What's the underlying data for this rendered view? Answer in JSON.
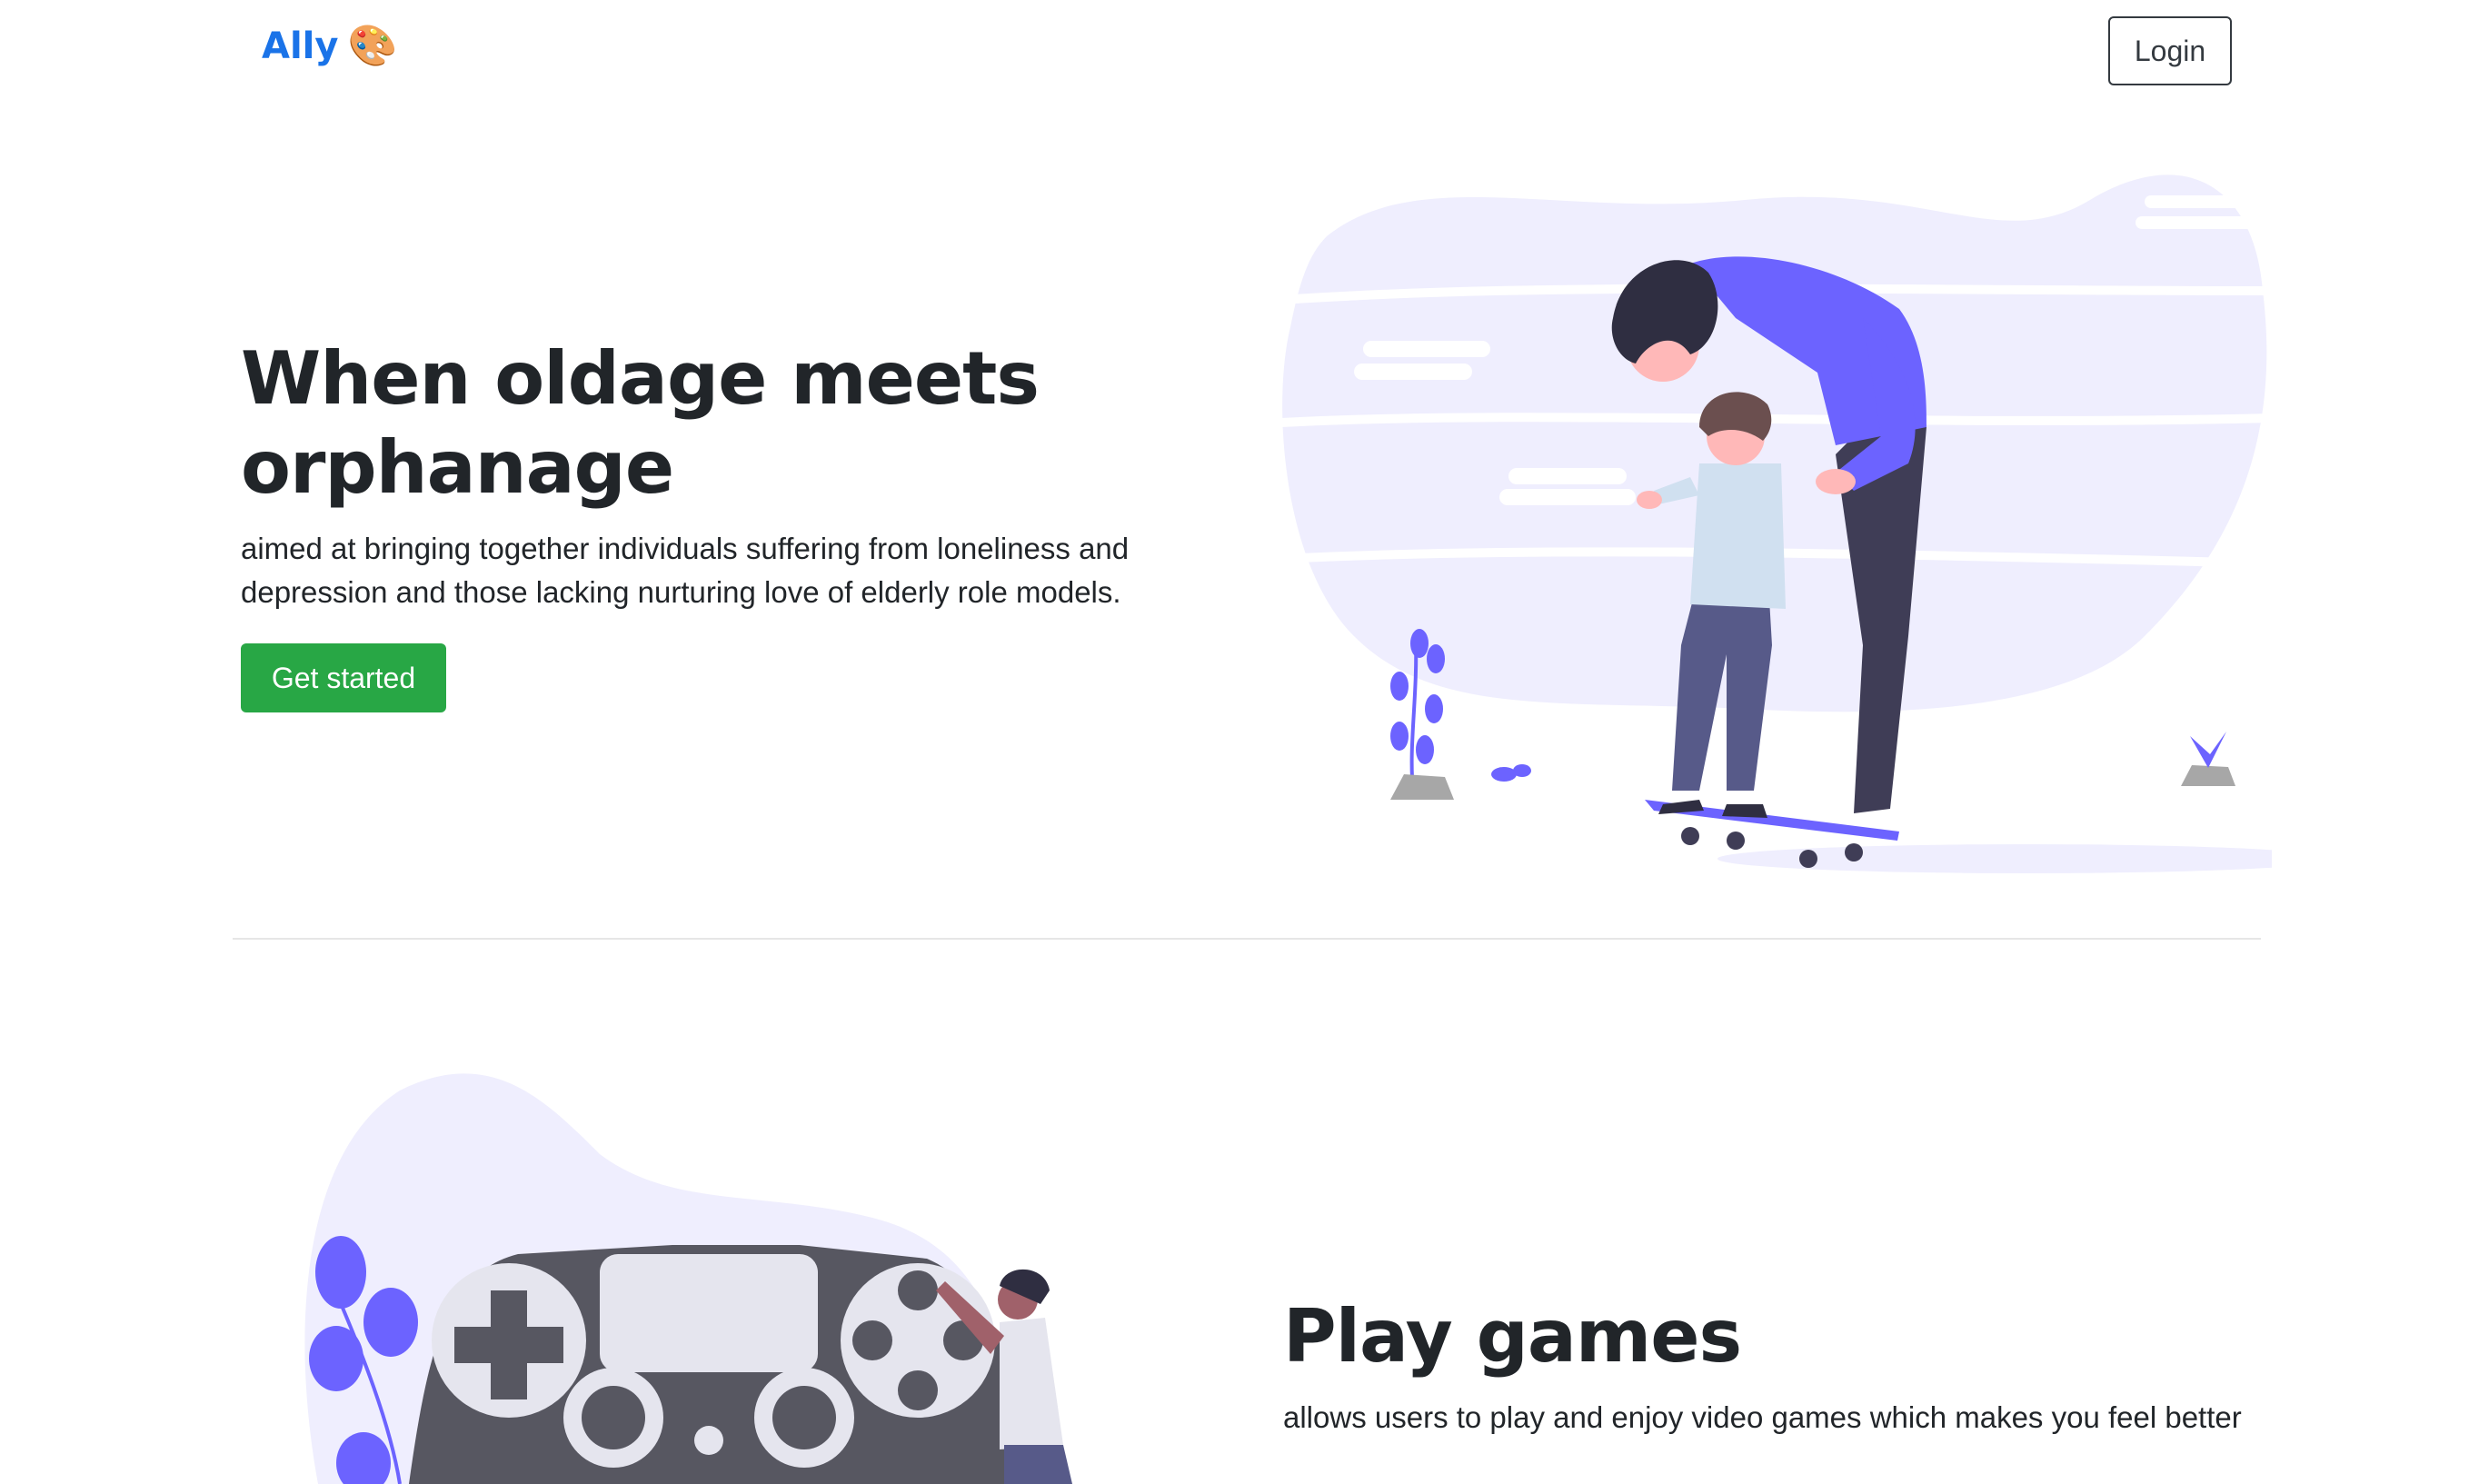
{
  "navbar": {
    "brand": "Ally",
    "brand_icon": "palette-icon",
    "login_label": "Login"
  },
  "hero": {
    "title": "When oldage meets orphanage",
    "description": "aimed at bringing together individuals suffering from loneliness and depression and those lacking nurturing love of elderly role models.",
    "cta_label": "Get started",
    "illustration": "father-teaching-child-skateboard-illustration"
  },
  "feature": {
    "title": "Play games",
    "description": "allows users to play and enjoy video games which makes you feel better",
    "illustration": "person-with-game-controller-illustration"
  },
  "colors": {
    "brand": "#1a73e8",
    "success": "#28a745",
    "accent": "#6c63ff",
    "blob": "#efeefe",
    "controller": "#575761"
  }
}
